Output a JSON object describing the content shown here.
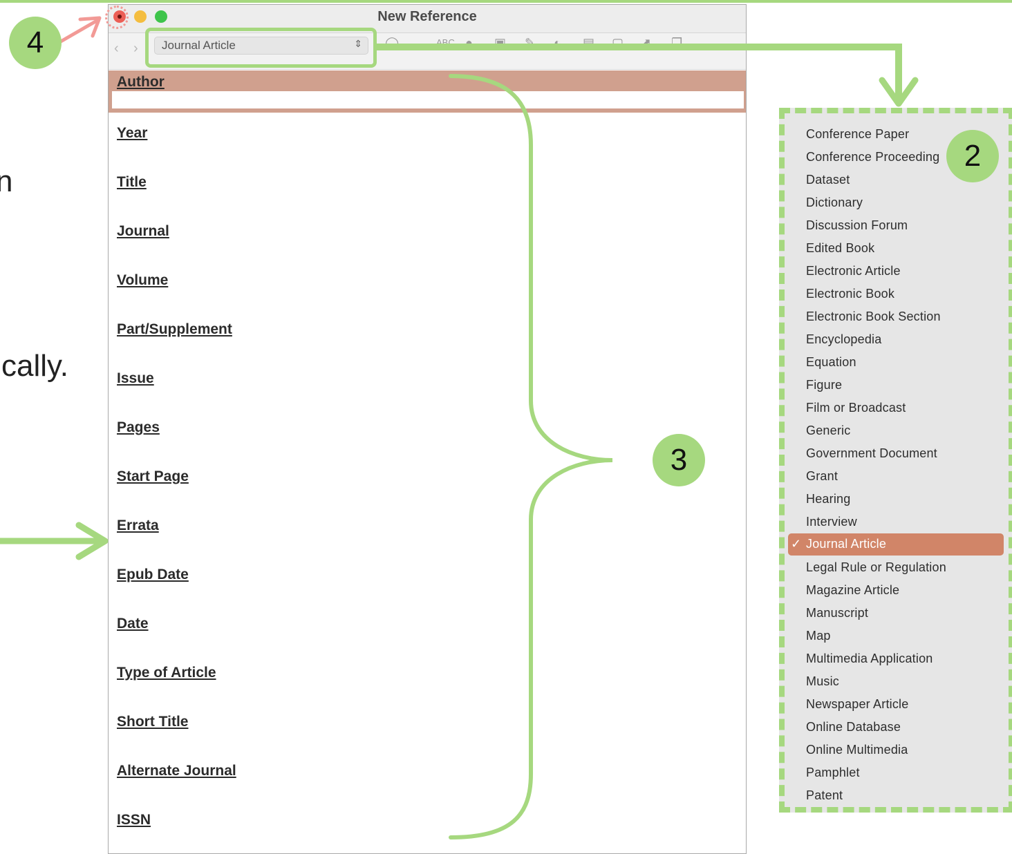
{
  "window": {
    "title": "New Reference",
    "reference_type": "Journal Article",
    "toolbar": {
      "back_icon": "chevron-left",
      "forward_icon": "chevron-right",
      "select_chevron": "⌃⌄",
      "icons": [
        "search-icon",
        "spellcheck-icon",
        "pin-icon",
        "attach-figure-icon",
        "paperclip-icon",
        "pie-chart-icon",
        "chart-icon",
        "document-icon",
        "export-icon",
        "copy-icon"
      ],
      "spellcheck_text": "ABC"
    },
    "fields": [
      "Author",
      "Year",
      "Title",
      "Journal",
      "Volume",
      "Part/Supplement",
      "Issue",
      "Pages",
      "Start Page",
      "Errata",
      "Epub Date",
      "Date",
      "Type of Article",
      "Short Title",
      "Alternate Journal",
      "ISSN"
    ]
  },
  "background_text": {
    "fragment_1": "n",
    "fragment_2": "cally."
  },
  "annotations": {
    "callout_4": "4",
    "callout_2": "2",
    "callout_3": "3",
    "accent_color": "#a6d87f",
    "highlight_color": "#f29a96"
  },
  "menu": {
    "items": [
      "Conference Paper",
      "Conference Proceeding",
      "Dataset",
      "Dictionary",
      "Discussion Forum",
      "Edited Book",
      "Electronic Article",
      "Electronic Book",
      "Electronic Book Section",
      "Encyclopedia",
      "Equation",
      "Figure",
      "Film or Broadcast",
      "Generic",
      "Government Document",
      "Grant",
      "Hearing",
      "Interview",
      "Journal Article",
      "Legal Rule or Regulation",
      "Magazine Article",
      "Manuscript",
      "Map",
      "Multimedia Application",
      "Music",
      "Newspaper Article",
      "Online Database",
      "Online Multimedia",
      "Pamphlet",
      "Patent"
    ],
    "selected": "Journal Article",
    "check_mark": "✓",
    "selected_color": "#d18568"
  }
}
